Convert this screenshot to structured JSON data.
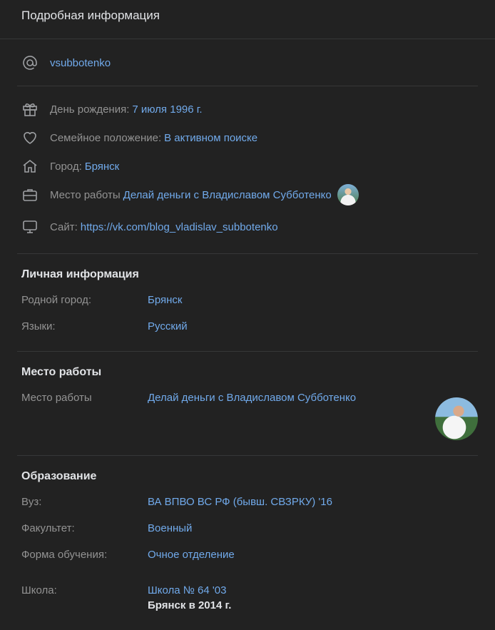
{
  "header": {
    "title": "Подробная информация"
  },
  "contact": {
    "username": "vsubbotenko"
  },
  "details": {
    "birthday_label": "День рождения: ",
    "birthday_value": "7 июля 1996 г.",
    "relationship_label": "Семейное положение: ",
    "relationship_value": "В активном поиске",
    "city_label": "Город: ",
    "city_value": "Брянск",
    "work_label": "Место работы ",
    "work_value": "Делай деньги с Владиславом Субботенко",
    "site_label": "Сайт: ",
    "site_value": "https://vk.com/blog_vladislav_subbotenko"
  },
  "personal": {
    "title": "Личная информация",
    "hometown_label": "Родной город:",
    "hometown_value": "Брянск",
    "languages_label": "Языки:",
    "languages_value": "Русский"
  },
  "work": {
    "title": "Место работы",
    "label": "Место работы",
    "value": "Делай деньги с Владиславом Субботенко"
  },
  "education": {
    "title": "Образование",
    "university_label": "Вуз:",
    "university_value": "ВА ВПВО ВС РФ (бывш. СВЗРКУ) '16",
    "faculty_label": "Факультет:",
    "faculty_value": "Военный",
    "form_label": "Форма обучения:",
    "form_value": "Очное отделение",
    "school_label": "Школа:",
    "school_value": "Школа № 64 '03",
    "school_city": "Брянск в 2014 г."
  },
  "icons": [
    "at-icon",
    "gift-icon",
    "heart-icon",
    "home-icon",
    "briefcase-icon",
    "monitor-icon"
  ],
  "colors": {
    "background": "#222222",
    "link": "#71aaeb",
    "muted": "#939393",
    "text": "#e1e3e6"
  }
}
